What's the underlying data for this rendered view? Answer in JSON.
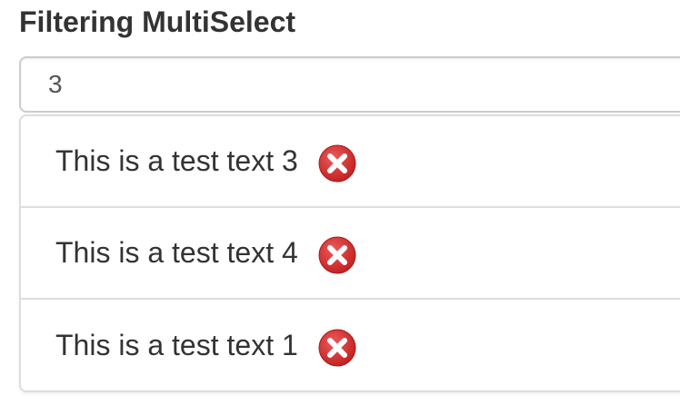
{
  "header": {
    "title": "Filtering MultiSelect"
  },
  "filter": {
    "value": "3"
  },
  "selected_items": [
    {
      "label": "This is a test text 3",
      "icon": "remove-icon"
    },
    {
      "label": "This is a test text 4",
      "icon": "remove-icon"
    },
    {
      "label": "This is a test text 1",
      "icon": "remove-icon"
    }
  ],
  "colors": {
    "remove_icon": "#d43131",
    "border": "#dddddd"
  }
}
